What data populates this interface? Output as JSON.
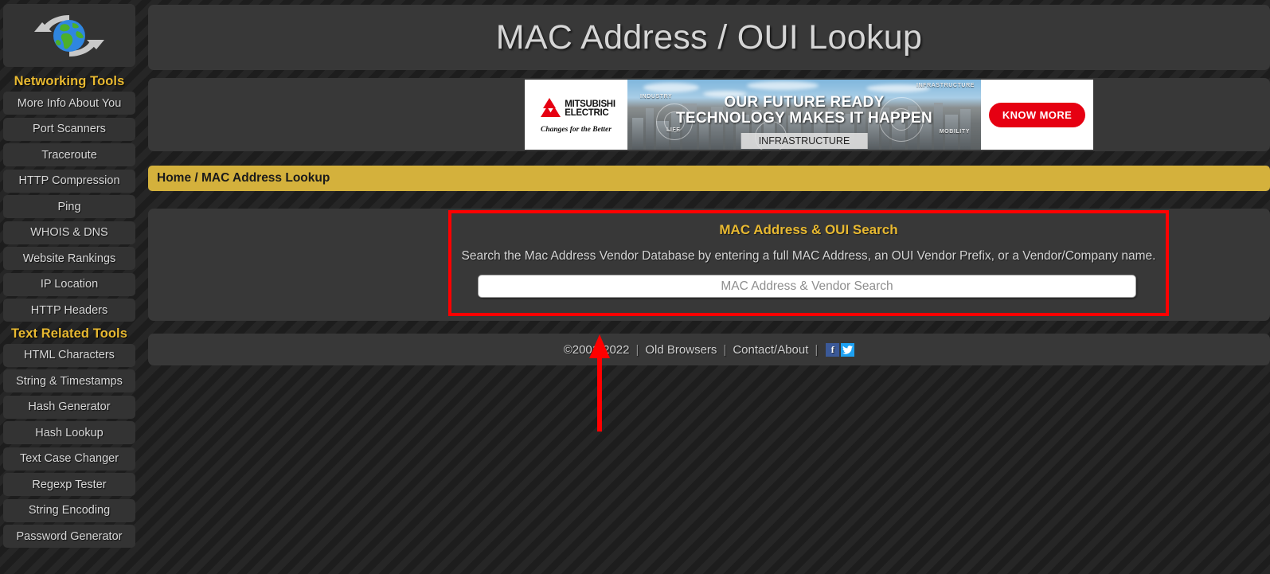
{
  "page": {
    "title": "MAC Address / OUI Lookup"
  },
  "sidebar": {
    "logo_icon": "globe-refresh-icon",
    "sections": [
      {
        "heading": "Networking Tools",
        "items": [
          "More Info About You",
          "Port Scanners",
          "Traceroute",
          "HTTP Compression",
          "Ping",
          "WHOIS & DNS",
          "Website Rankings",
          "IP Location",
          "HTTP Headers"
        ]
      },
      {
        "heading": "Text Related Tools",
        "items": [
          "HTML Characters",
          "String & Timestamps",
          "Hash Generator",
          "Hash Lookup",
          "Text Case Changer",
          "Regexp Tester",
          "String Encoding",
          "Password Generator"
        ]
      }
    ]
  },
  "ad": {
    "brand_line1": "MITSUBISHI",
    "brand_line2": "ELECTRIC",
    "brand_tagline": "Changes for the Better",
    "headline_line1": "OUR FUTURE READY",
    "headline_line2": "TECHNOLOGY MAKES IT HAPPEN",
    "category_chip": "INFRASTRUCTURE",
    "corner_labels": {
      "top_left": "INDUSTRY",
      "top_right": "INFRASTRUCTURE",
      "bottom_left": "LIFE",
      "bottom_right": "MOBILITY"
    },
    "cta_label": "KNOW MORE"
  },
  "breadcrumb": {
    "home": "Home",
    "separator": " / ",
    "current": "MAC Address Lookup"
  },
  "search": {
    "title": "MAC Address & OUI Search",
    "description": "Search the Mac Address Vendor Database by entering a full MAC Address, an OUI Vendor Prefix, or a Vendor/Company name.",
    "input_value": "",
    "input_placeholder": "MAC Address & Vendor Search",
    "highlight_color": "#ff0000"
  },
  "footer": {
    "copyright": "©2001-2022",
    "old_browsers": "Old Browsers",
    "contact_about": "Contact/About",
    "separator": "|",
    "facebook_icon": "facebook-icon",
    "facebook_glyph": "f",
    "twitter_icon": "twitter-icon"
  },
  "annotation": {
    "arrow_icon": "red-up-arrow",
    "color": "#ff0000"
  },
  "theme": {
    "accent_yellow": "#e8b931",
    "breadcrumb_yellow": "#d4b13c",
    "panel_bg": "#383838",
    "page_bg": "#202020"
  }
}
